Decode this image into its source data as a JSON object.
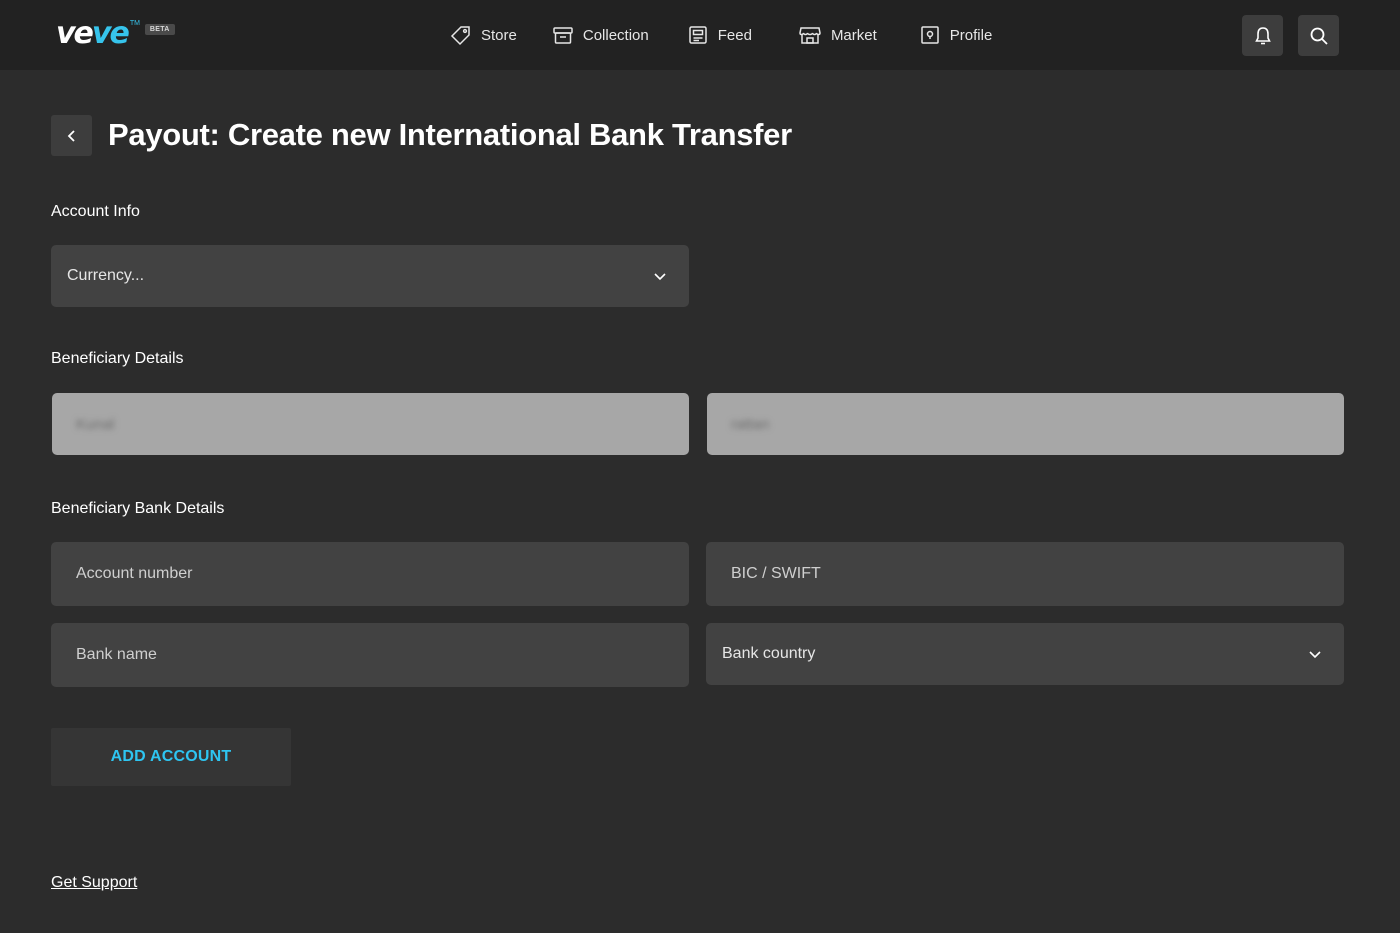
{
  "brand": {
    "logo_part1": "ve",
    "logo_part2": "ve",
    "trademark": "TM",
    "beta_badge": "BETA",
    "accent_color": "#36c4ec"
  },
  "nav": {
    "items": [
      {
        "label": "Store",
        "icon": "store-tag-icon"
      },
      {
        "label": "Collection",
        "icon": "collection-box-icon"
      },
      {
        "label": "Feed",
        "icon": "feed-document-icon"
      },
      {
        "label": "Market",
        "icon": "market-storefront-icon"
      },
      {
        "label": "Profile",
        "icon": "profile-card-icon"
      }
    ],
    "actions": [
      {
        "icon": "bell-icon"
      },
      {
        "icon": "search-icon"
      }
    ]
  },
  "header": {
    "back_icon": "chevron-left-icon",
    "title": "Payout: Create new International Bank Transfer"
  },
  "account_info": {
    "label": "Account Info",
    "currency_placeholder": "Currency..."
  },
  "beneficiary": {
    "label": "Beneficiary Details",
    "first_name_value": "Kunal",
    "last_name_value": "rattan"
  },
  "bank_details": {
    "label": "Beneficiary Bank Details",
    "account_number_placeholder": "Account number",
    "bic_placeholder": "BIC / SWIFT",
    "bank_name_placeholder": "Bank name",
    "bank_country_placeholder": "Bank country"
  },
  "actions": {
    "add_account_label": "ADD ACCOUNT",
    "add_account_color": "#2ec5f1"
  },
  "footer": {
    "support_link": "Get Support"
  }
}
